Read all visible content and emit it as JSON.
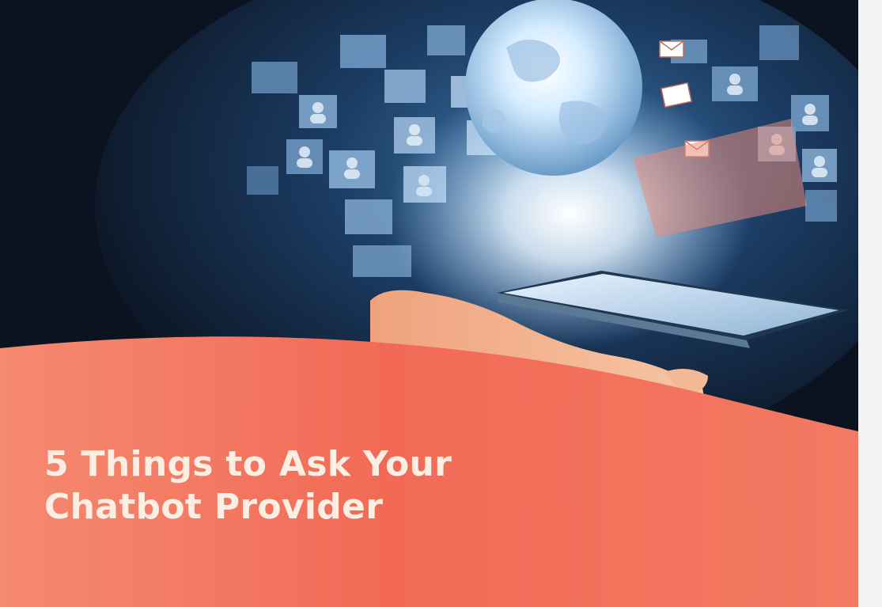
{
  "banner": {
    "title_line_1": "5 Things to Ask Your",
    "title_line_2": "Chatbot Provider"
  },
  "colors": {
    "background_dark": "#0b1320",
    "globe_glow": "#cfe8ff",
    "panel_blue": "#7fa6cc",
    "wave_coral": "#f26a56",
    "wave_light": "#f58a70",
    "title_text": "#fbefe3"
  },
  "artwork": {
    "elements": [
      "globe-icon",
      "phone-icon",
      "hand-icon",
      "email-icon",
      "user-avatar-icon"
    ]
  }
}
